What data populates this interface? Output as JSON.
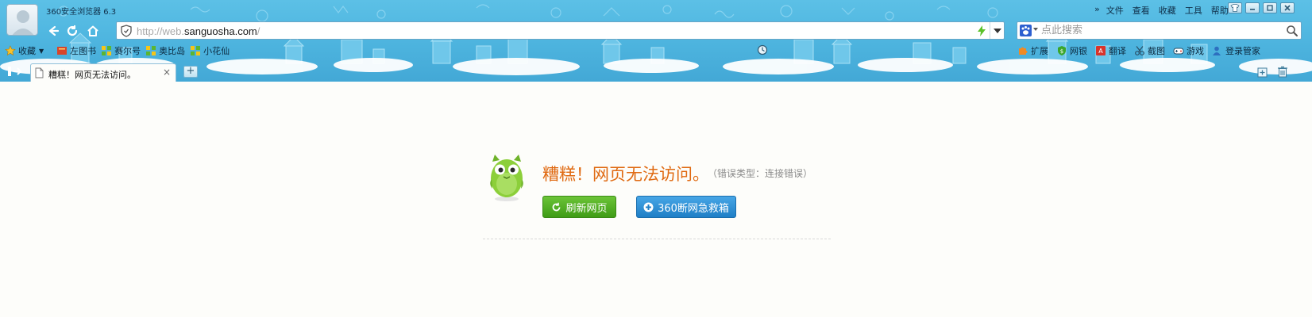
{
  "window": {
    "title": "360安全浏览器 6.3"
  },
  "menu": {
    "items": [
      "文件",
      "查看",
      "收藏",
      "工具",
      "帮助"
    ]
  },
  "address_bar": {
    "url_scheme": "http://web.",
    "url_host": "sanguosha.com",
    "url_tail": "/"
  },
  "search": {
    "placeholder": "点此搜索"
  },
  "favorites": {
    "items": [
      {
        "label": "收藏",
        "icon": "star-icon"
      },
      {
        "label": "左图书",
        "icon": "book-icon"
      },
      {
        "label": "赛尔号",
        "icon": "game-grid-icon"
      },
      {
        "label": "奥比岛",
        "icon": "game-grid-icon"
      },
      {
        "label": "小花仙",
        "icon": "game-grid-icon"
      }
    ]
  },
  "toolbar": {
    "items": [
      {
        "label": "扩展",
        "icon": "puzzle-icon"
      },
      {
        "label": "网银",
        "icon": "shield-money-icon"
      },
      {
        "label": "翻译",
        "icon": "translate-icon"
      },
      {
        "label": "截图",
        "icon": "scissors-icon"
      },
      {
        "label": "游戏",
        "icon": "gamepad-icon"
      },
      {
        "label": "登录管家",
        "icon": "user-key-icon"
      }
    ]
  },
  "tab": {
    "title": "糟糕！网页无法访问。",
    "close": "×",
    "new_tab": "+"
  },
  "error_page": {
    "title": "糟糕！网页无法访问。",
    "error_type": "（错误类型：连接错误）",
    "refresh_label": "刷新网页",
    "rescue_label": "360断网急救箱"
  },
  "colors": {
    "chrome_blue": "#4fb6e0",
    "title_orange": "#e06a12",
    "refresh_green": "#4fae22",
    "rescue_blue": "#2d8fd4"
  }
}
